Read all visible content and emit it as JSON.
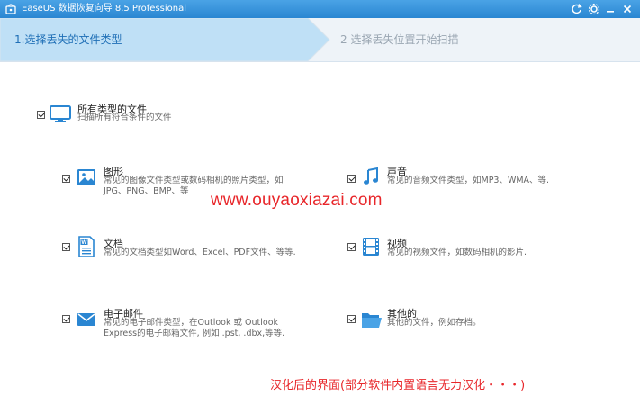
{
  "window": {
    "title": "EaseUS 数据恢复向导 8.5 Professional",
    "controls": [
      "refresh-icon",
      "settings-icon",
      "minimize-icon",
      "close-icon"
    ],
    "accent": "#2a86d2"
  },
  "steps": {
    "step1": "1.选择丢失的文件类型",
    "step2": "2 选择丢失位置开始扫描"
  },
  "all_types": {
    "checked": true,
    "title": "所有类型的文件",
    "desc": "扫描所有符合条件的文件"
  },
  "types": {
    "image": {
      "checked": true,
      "title": "图形",
      "desc_line1": "常见的图像文件类型或数码相机的照片类型，如",
      "desc_line2": "JPG、PNG、BMP、等"
    },
    "audio": {
      "checked": true,
      "title": "声音",
      "desc_line1": "常见的音频文件类型，如MP3、WMA、等."
    },
    "document": {
      "checked": true,
      "title": "文档",
      "desc_line1": "常见的文档类型如Word、Excel、PDF文件、等等."
    },
    "video": {
      "checked": true,
      "title": "视频",
      "desc_line1": "常见的视频文件，如数码相机的影片."
    },
    "email": {
      "checked": true,
      "title": "电子邮件",
      "desc_line1": "常见的电子邮件类型，在Outlook 或 Outlook",
      "desc_line2": "Express的电子邮箱文件, 例如 .pst, .dbx,等等."
    },
    "other": {
      "checked": true,
      "title": "其他的",
      "desc_line1": "其他的文件，例如存档。"
    }
  },
  "overlay": {
    "watermark": "www.ouyaoxiazai.com",
    "caption": "汉化后的界面(部分软件内置语言无力汉化・・・)",
    "color": "#e8262a"
  }
}
